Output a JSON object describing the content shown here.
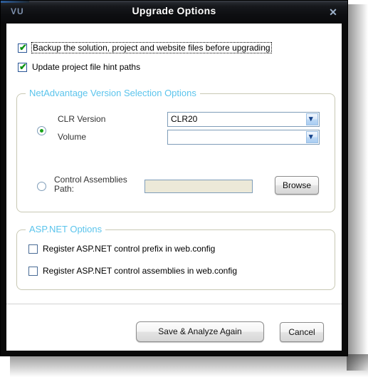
{
  "window": {
    "app_logo": "VU",
    "title": "Upgrade Options",
    "close_icon": "✕"
  },
  "options": {
    "backup": {
      "label": "Backup the solution, project and website files before upgrading",
      "checked": true,
      "focused": true,
      "check_glyph": "✔"
    },
    "hint_paths": {
      "label": "Update project file hint paths",
      "checked": true,
      "focused": false,
      "check_glyph": "✔"
    }
  },
  "netadvantage_group": {
    "title": "NetAdvantage Version Selection Options",
    "version_radio_selected": true,
    "clr_version_label": "CLR Version",
    "clr_version_value": "CLR20",
    "volume_label": "Volume",
    "volume_value": "",
    "chevron_glyph": "▾",
    "path_radio_selected": false,
    "control_assemblies_label": "Control Assemblies Path:",
    "control_assemblies_value": "",
    "browse_label": "Browse"
  },
  "aspnet_group": {
    "title": "ASP.NET Options",
    "prefix": {
      "label": "Register ASP.NET control prefix in web.config",
      "checked": false
    },
    "assemblies": {
      "label": "Register ASP.NET control assemblies in web.config",
      "checked": false
    }
  },
  "footer": {
    "save_label": "Save & Analyze Again",
    "cancel_label": "Cancel"
  },
  "colors": {
    "group_title": "#5bc4ec",
    "check_green": "#0f9314",
    "radio_green": "#19a319",
    "titlebar": "#0a0a0c",
    "disabled_field": "#ece9d8"
  }
}
